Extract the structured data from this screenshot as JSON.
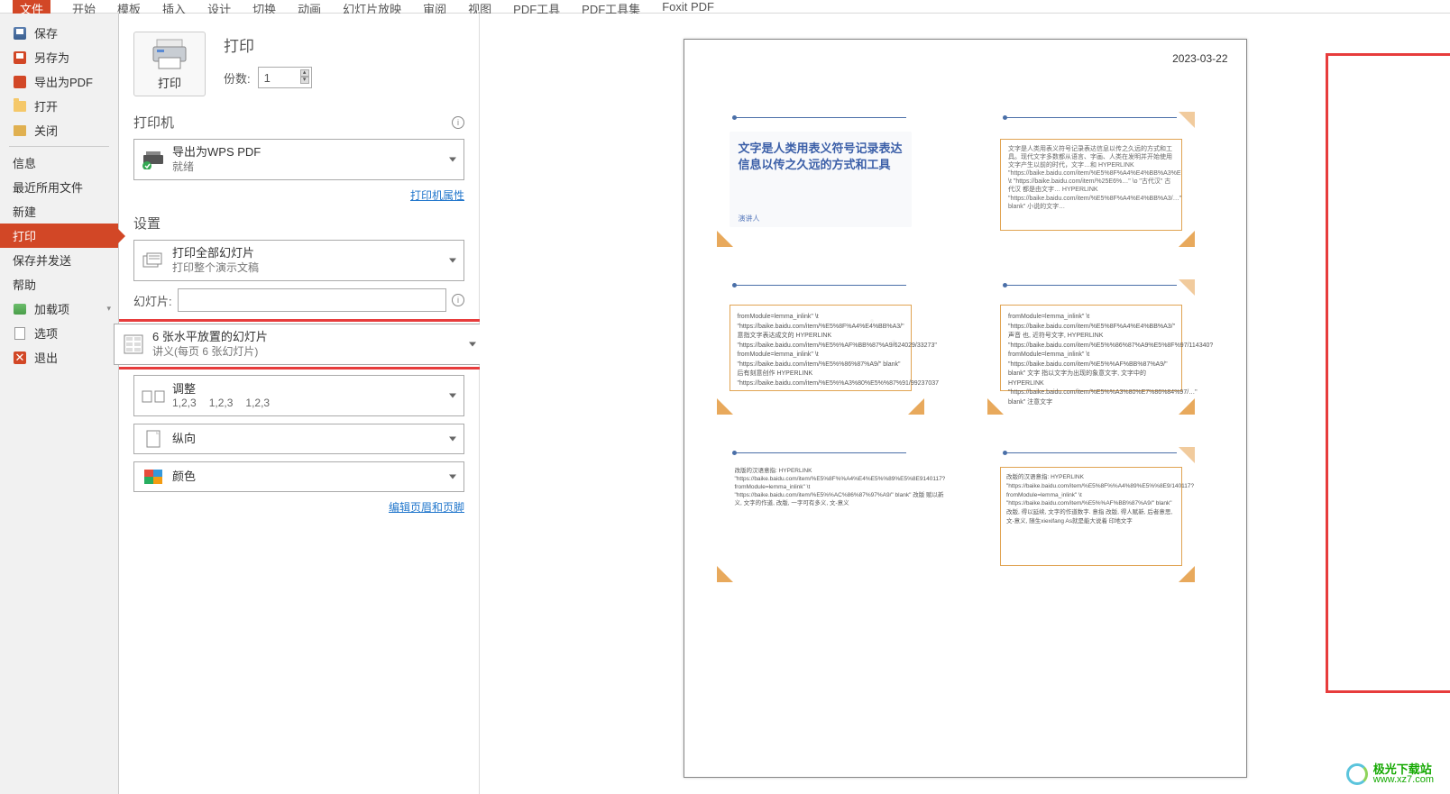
{
  "ribbon": {
    "file_tab": "文件",
    "tabs": [
      "开始",
      "模板",
      "插入",
      "设计",
      "切换",
      "动画",
      "幻灯片放映",
      "审阅",
      "视图",
      "PDF工具",
      "PDF工具集",
      "Foxit PDF"
    ]
  },
  "sidebar": {
    "save": "保存",
    "save_as": "另存为",
    "export_pdf": "导出为PDF",
    "open": "打开",
    "close": "关闭",
    "info": "信息",
    "recent": "最近所用文件",
    "new": "新建",
    "print": "打印",
    "save_send": "保存并发送",
    "help": "帮助",
    "addins": "加载项",
    "options": "选项",
    "exit": "退出"
  },
  "center": {
    "print_big": "打印",
    "print_title": "打印",
    "copies_label": "份数:",
    "copies_value": "1",
    "printer_label": "打印机",
    "printer_name": "导出为WPS PDF",
    "printer_status": "就绪",
    "printer_props": "打印机属性",
    "settings_label": "设置",
    "dd1_title": "打印全部幻灯片",
    "dd1_sub": "打印整个演示文稿",
    "slides_label": "幻灯片:",
    "dd2_title": "6 张水平放置的幻灯片",
    "dd2_sub": "讲义(每页 6 张幻灯片)",
    "dd3_title": "调整",
    "dd3_nums": [
      "1,2,3",
      "1,2,3",
      "1,2,3"
    ],
    "dd4_title": "纵向",
    "dd5_title": "颜色",
    "footer_link": "编辑页眉和页脚"
  },
  "preview": {
    "date": "2023-03-22",
    "slide1_title": "文字是人类用表义符号记录表达信息以传之久远的方式和工具",
    "slide1_speaker": "演讲人",
    "slide2_text": "文字是人类用表义符号记录表达信息以传之久远的方式和工具。现代文字多数都从语言、字画、人类在发明并开始使用文字产生以前的时代，文字…和 HYPERLINK \"https://baike.baidu.com/item/%E5%8F%A4%E4%BB%A3%E6%B1%89/…\" \\t \"https://baike.baidu.com/item/%25E6%…\" \\o \"古代汉\" 古代汉 都是由文字… HYPERLINK \"https://baike.baidu.com/item/%E5%8F%A4%E4%BB%A3/…\" blank\" 小说的文字…",
    "slide3_text": "fromModule=lemma_inlink\" \\t \"https://baike.baidu.com/item/%E5%8F%A4%E4%BB%A3/\" 意指文字表达成文的 HYPERLINK \"https://baike.baidu.com/item/%E5%%AF%BB%87%A9/624029/33273\" fromModule=lemma_inlink\" \\t \"https://baike.baidu.com/item/%E5%%86%87%A9/\" blank\" 后有刻意创作 HYPERLINK \"https://baike.baidu.com/item/%E5%%A3%80%E5%%87%91/99237037",
    "slide4_text": "fromModule=lemma_inlink\" \\t \"https://baike.baidu.com/item/%E5%8F%A4%E4%BB%A3/\" 声音 也, 近符号文字, HYPERLINK \"https://baike.baidu.com/item/%E5%%86%87%A9%E5%8F%97/114340?fromModule=lemma_inlink\" \\t \"https://baike.baidu.com/item/%E5%%AF%BB%87%A9/\" blank\" 文字 指以文字为出现的象意文字, 文字中的 HYPERLINK \"https://baike.baidu.com/item/%E5%%A3%80%E7%86%84%97/…\" blank\" 注意文字",
    "slide5_text": "改版的汉语意指: HYPERLINK \"https://baike.baidu.com/item/%E5%8F%%A4%E4%E5%%89%E5%8E9140117?fromModule=lemma_inlink\" \\t \"https://baike.baidu.com/item/%E5%%AC%86%87%97%A9/\" blank\" 改版 赋以新义, 文字的作道, 改版, 一字可有多义, 文-意义",
    "slide6_text": "改版的汉语意指: HYPERLINK \"https://baike.baidu.com/item/%E5%8F%%A4%89%E5%%8E9/140117?fromModule=lemma_inlink\" \\t \"https://baike.baidu.com/item/%E5%%AF%BB%87%A9/\" blank\" 改版, 得以延续, 文字的作道数字. 意指 改版, 得人赋新, 后者意思, 文-意义, 随生xiexifang\nAs就是能大说着\n印地文字"
  },
  "watermark": {
    "cn": "极光下载站",
    "url": "www.xz7.com"
  }
}
